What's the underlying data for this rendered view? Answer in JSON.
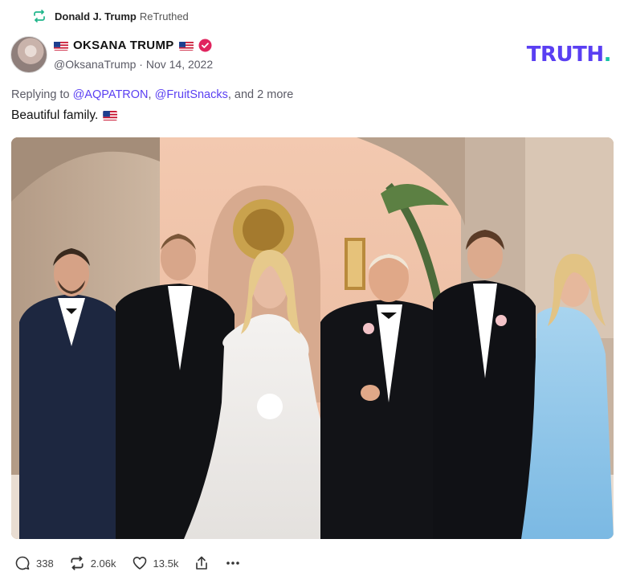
{
  "retruth": {
    "icon": "retruth-icon",
    "user": "Donald J. Trump",
    "label": "ReTruthed"
  },
  "author": {
    "display_name": "OKSANA TRUMP",
    "handle": "@OksanaTrump",
    "separator": "·",
    "date": "Nov 14, 2022",
    "verified_icon": "verified-badge-icon",
    "flag_icon": "us-flag-icon"
  },
  "brand": {
    "logo": "TRUTH",
    "logo_dot": ".",
    "primary_color": "#5a3ff2",
    "dot_color": "#18c3a5"
  },
  "post": {
    "replying_prefix": "Replying to",
    "mention_1": "@AQPATRON",
    "comma": ",",
    "mention_2": "@FruitSnacks",
    "replying_suffix": ", and 2 more",
    "text": "Beautiful family.",
    "image_icon": "wedding-family-photo"
  },
  "actions": {
    "replies": "338",
    "retruths": "2.06k",
    "likes": "13.5k"
  }
}
